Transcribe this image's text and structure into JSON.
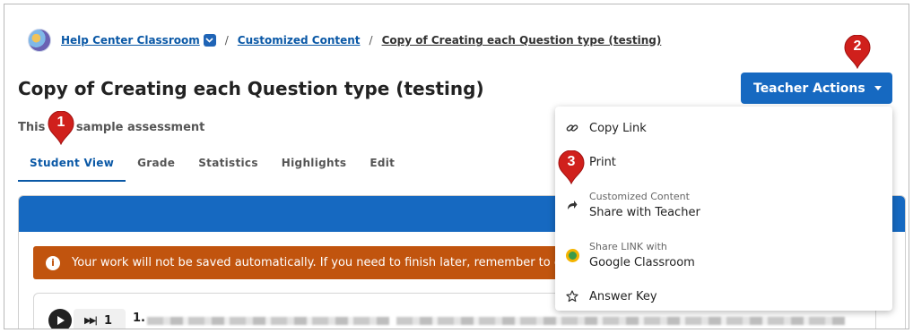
{
  "breadcrumb": {
    "classroom": "Help Center Classroom",
    "section": "Customized Content",
    "current": "Copy of Creating each Question type (testing)",
    "separator": "/"
  },
  "page": {
    "title": "Copy of Creating each Question type (testing)",
    "subtitle": "This is a sample assessment"
  },
  "tabs": [
    {
      "label": "Student View",
      "active": true
    },
    {
      "label": "Grade",
      "active": false
    },
    {
      "label": "Statistics",
      "active": false
    },
    {
      "label": "Highlights",
      "active": false
    },
    {
      "label": "Edit",
      "active": false
    }
  ],
  "alert": {
    "icon": "info-icon",
    "text": "Your work will not be saved automatically. If you need to finish later, remember to click"
  },
  "question": {
    "number": "1.",
    "step": "1"
  },
  "teacher_actions": {
    "label": "Teacher Actions",
    "menu": [
      {
        "icon": "link-icon",
        "label": "Copy Link"
      },
      {
        "icon": "print-icon",
        "label": "Print"
      },
      {
        "icon": "share-icon",
        "sublabel": "Customized Content",
        "label": "Share with Teacher"
      },
      {
        "icon": "google-classroom-icon",
        "sublabel": "Share LINK with",
        "label": "Google Classroom"
      },
      {
        "icon": "star-icon",
        "label": "Answer Key"
      }
    ]
  },
  "markers": [
    "1",
    "2",
    "3"
  ],
  "colors": {
    "accent": "#1669c1",
    "alert": "#c1540e",
    "marker": "#d0201c"
  }
}
